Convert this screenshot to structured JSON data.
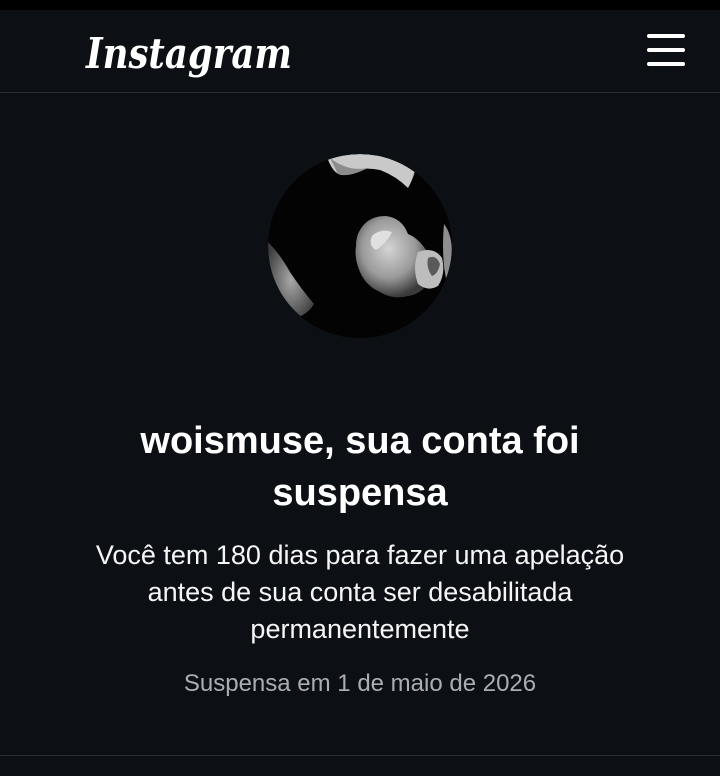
{
  "header": {
    "logo_text": "Instagram",
    "menu_icon": "hamburger-menu-icon"
  },
  "profile": {
    "username": "woismuse"
  },
  "notice": {
    "title": "woismuse, sua conta foi suspensa",
    "description": "Você tem 180 dias para fazer uma apelação antes de sua conta ser desabilitada permanentemente",
    "suspended_date": "Suspensa em 1 de maio de 2026"
  },
  "colors": {
    "background": "#0c1014",
    "divider": "#2b3036",
    "text_primary": "#ffffff",
    "text_secondary": "#a8aeb5"
  }
}
